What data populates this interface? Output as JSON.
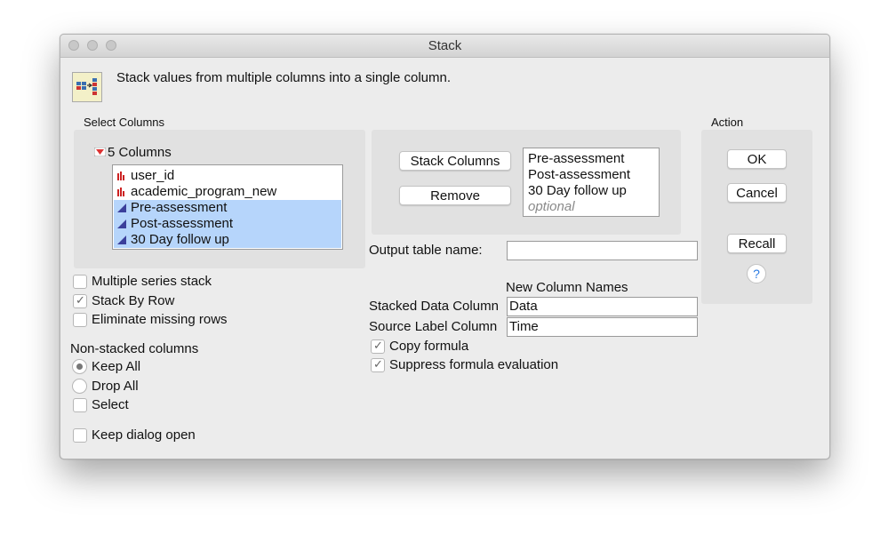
{
  "window": {
    "title": "Stack"
  },
  "description": "Stack values from multiple columns into a single column.",
  "select_columns": {
    "header": "Select Columns",
    "group_label": "5 Columns",
    "columns": [
      {
        "name": "user_id",
        "type": "nominal",
        "selected": false
      },
      {
        "name": "academic_program_new",
        "type": "nominal",
        "selected": false
      },
      {
        "name": "Pre-assessment",
        "type": "continuous",
        "selected": true
      },
      {
        "name": "Post-assessment",
        "type": "continuous",
        "selected": true
      },
      {
        "name": "30 Day follow up",
        "type": "continuous",
        "selected": true
      }
    ]
  },
  "roles": {
    "stack_columns_button": "Stack Columns",
    "remove_button": "Remove",
    "stacked": [
      "Pre-assessment",
      "Post-assessment",
      "30 Day follow up"
    ],
    "optional_placeholder": "optional"
  },
  "action": {
    "header": "Action",
    "ok": "OK",
    "cancel": "Cancel",
    "recall": "Recall",
    "help": "?"
  },
  "options": {
    "multiple_series_stack": {
      "label": "Multiple series stack",
      "checked": false
    },
    "stack_by_row": {
      "label": "Stack By Row",
      "checked": true
    },
    "eliminate_missing_rows": {
      "label": "Eliminate missing rows",
      "checked": false
    }
  },
  "non_stacked": {
    "header": "Non-stacked columns",
    "keep_all": {
      "label": "Keep All",
      "selected": true
    },
    "drop_all": {
      "label": "Drop All",
      "selected": false
    },
    "select": {
      "label": "Select",
      "checked": false
    }
  },
  "keep_dialog_open": {
    "label": "Keep dialog open",
    "checked": false
  },
  "output": {
    "table_name_label": "Output table name:",
    "table_name_value": "",
    "new_column_names_header": "New Column Names",
    "stacked_data_label": "Stacked Data Column",
    "stacked_data_value": "Data",
    "source_label_label": "Source Label Column",
    "source_label_value": "Time",
    "copy_formula": {
      "label": "Copy formula",
      "checked": true
    },
    "suppress_formula": {
      "label": "Suppress formula evaluation",
      "checked": true
    }
  }
}
